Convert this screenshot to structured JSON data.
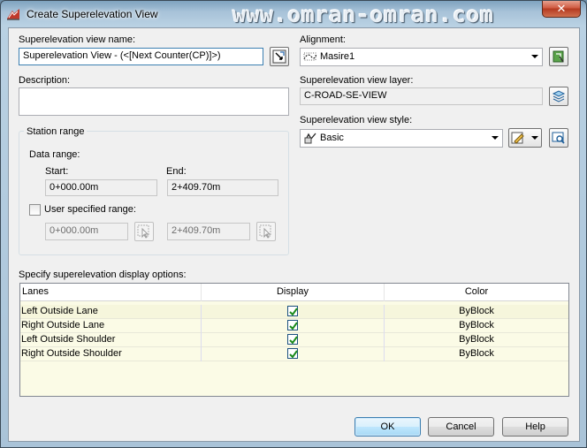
{
  "window": {
    "title": "Create Superelevation View",
    "watermark": "www.omran-omran.com",
    "close_label": "✕"
  },
  "view_name": {
    "label": "Superelevation view name:",
    "value": "Superelevation View - (<[Next Counter(CP)]>)"
  },
  "description": {
    "label": "Description:",
    "value": ""
  },
  "station_range": {
    "title": "Station range",
    "data_range_label": "Data range:",
    "start_label": "Start:",
    "end_label": "End:",
    "start_value": "0+000.00m",
    "end_value": "2+409.70m",
    "user_specified_label": "User specified range:",
    "user_specified_checked": false,
    "user_start_value": "0+000.00m",
    "user_end_value": "2+409.70m"
  },
  "alignment": {
    "label": "Alignment:",
    "value": "Masire1"
  },
  "layer": {
    "label": "Superelevation view layer:",
    "value": "C-ROAD-SE-VIEW"
  },
  "style": {
    "label": "Superelevation view style:",
    "value": "Basic"
  },
  "display_options": {
    "label": "Specify superelevation display options:",
    "columns": [
      "Lanes",
      "Display",
      "Color"
    ],
    "rows": [
      {
        "lane": "Left Outside Lane",
        "display": true,
        "color": "ByBlock"
      },
      {
        "lane": "Right Outside Lane",
        "display": true,
        "color": "ByBlock"
      },
      {
        "lane": "Left Outside Shoulder",
        "display": true,
        "color": "ByBlock"
      },
      {
        "lane": "Right Outside Shoulder",
        "display": true,
        "color": "ByBlock"
      }
    ]
  },
  "buttons": {
    "ok": "OK",
    "cancel": "Cancel",
    "help": "Help"
  },
  "icons": {
    "app": "civil3d-superelevation-icon",
    "edit_name": "edit-name-icon",
    "select_alignment": "select-alignment-icon",
    "layer": "layer-icon",
    "style_edit": "style-edit-icon",
    "style_preview": "style-preview-icon",
    "pick_station": "pick-station-icon"
  },
  "colors": {
    "grid_background": "#fbfbe6",
    "default_button": "#bee6fd",
    "titlebar": "#a7c2d8"
  }
}
